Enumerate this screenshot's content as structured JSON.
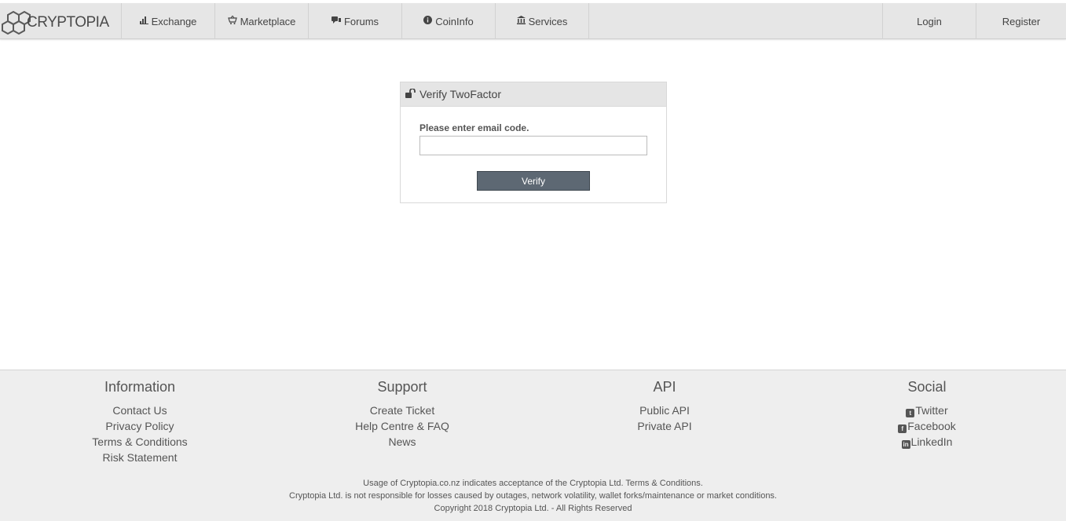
{
  "brand": {
    "name": "CRYPTOPIA"
  },
  "nav": {
    "items": [
      {
        "label": "Exchange",
        "icon": "bar-chart-icon"
      },
      {
        "label": "Marketplace",
        "icon": "basket-icon"
      },
      {
        "label": "Forums",
        "icon": "comments-icon"
      },
      {
        "label": "CoinInfo",
        "icon": "info-circle-icon"
      },
      {
        "label": "Services",
        "icon": "bank-icon"
      }
    ],
    "login": "Login",
    "register": "Register"
  },
  "panel": {
    "title": "Verify TwoFactor",
    "field_label": "Please enter email code.",
    "input_value": "",
    "input_placeholder": "",
    "button": "Verify"
  },
  "footer": {
    "information": {
      "title": "Information",
      "links": [
        "Contact Us",
        "Privacy Policy",
        "Terms & Conditions",
        "Risk Statement"
      ]
    },
    "support": {
      "title": "Support",
      "links": [
        "Create Ticket",
        "Help Centre & FAQ",
        "News"
      ]
    },
    "api": {
      "title": "API",
      "links": [
        "Public API",
        "Private API"
      ]
    },
    "social": {
      "title": "Social",
      "links": [
        "Twitter",
        "Facebook",
        "LinkedIn"
      ]
    },
    "legal": [
      "Usage of Cryptopia.co.nz indicates acceptance of the Cryptopia Ltd. Terms & Conditions.",
      "Cryptopia Ltd. is not responsible for losses caused by outages, network volatility, wallet forks/maintenance or market conditions.",
      "Copyright 2018 Cryptopia Ltd. - All Rights Reserved"
    ]
  },
  "colors": {
    "navbar_bg": "#e6e6e6",
    "button_bg": "#5d6873",
    "footer_bg": "#eeeeee"
  }
}
